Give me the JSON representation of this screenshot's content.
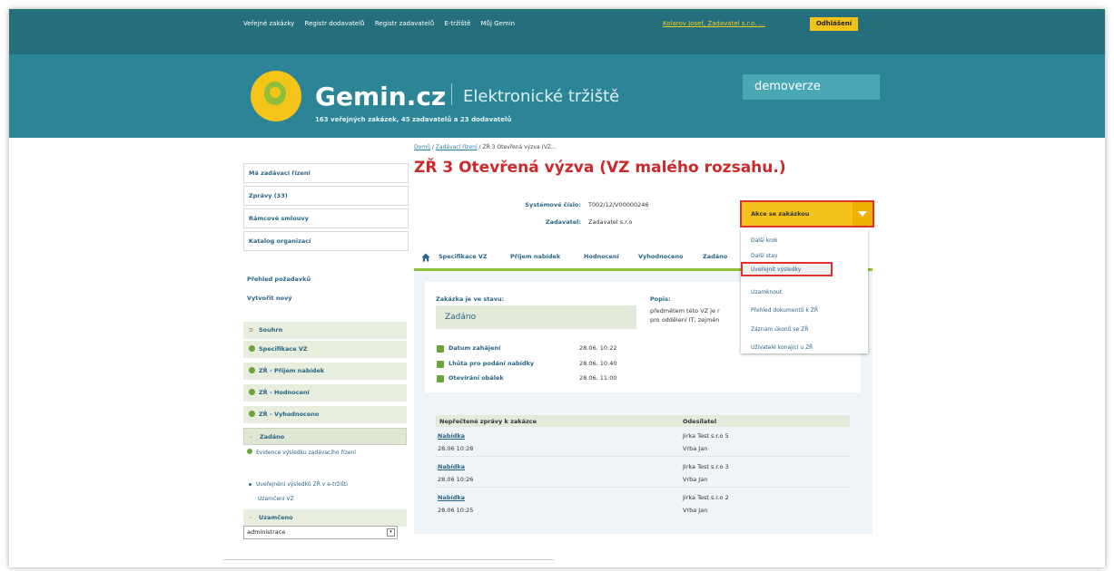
{
  "topnav": {
    "items": [
      "Veřejné zakázky",
      "Registr dodavatelů",
      "Registr zadavatelů",
      "E-tržiště",
      "Můj Gemin"
    ],
    "user": "Kolarov Josef, Zadavatel s.r.o. ...",
    "logout": "Odhlášení"
  },
  "header": {
    "brand": "Gemin.cz",
    "tagline": "Elektronické tržiště",
    "stats": "163 veřejných zakázek, 45 zadavatelů a 23 dodavatelů",
    "demo": "demoverze"
  },
  "breadcrumb": {
    "home": "Domů",
    "section": "Zadávací řízení",
    "current": " / ZŘ 3 Otevřená výzva (VZ..."
  },
  "title": "ZŘ 3 Otevřená výzva (VZ malého rozsahu.)",
  "meta": {
    "system_label": "Systémové číslo:",
    "system_value": "T002/12/V00000246",
    "contracting_label": "Zadavatel:",
    "contracting_value": "Zadavatel s.r.o"
  },
  "sidebar": {
    "boxes": [
      "Má zadávací řízení",
      "Zprávy (33)",
      "Rámcové smlouvy",
      "Katalog organizací"
    ],
    "links": [
      "Přehled požadavků",
      "Vytvořit nový"
    ],
    "summary": "Souhrn",
    "steps": [
      "Specifikace VZ",
      "ZŘ - Příjem nabídek",
      "ZŘ - Hodnocení",
      "ZŘ - Vyhodnoceno"
    ],
    "current": "Zadáno",
    "subs": [
      "Evidence výsledku zadávacího řízení",
      "Uveřejnění výsledků ZŘ v e-tržišti",
      "Uzamčení VZ"
    ],
    "locked": "Uzamčeno",
    "select_value": "administrace"
  },
  "tabs": [
    "Specifikace VZ",
    "Příjem nabídek",
    "Hodnocení",
    "Vyhodnoceno",
    "Zadáno"
  ],
  "status": {
    "label": "Zakázka je ve stavu:",
    "value": "Zadáno",
    "desc_label": "Popis:",
    "desc_line1": "předmětem této VZ je r",
    "desc_line2": "pro oddělení IT, zejmén"
  },
  "checks": [
    {
      "label": "Datum zahájení",
      "date": "28.06. 10:22"
    },
    {
      "label": "Lhůta pro podání nabídky",
      "date": "28.06. 10:40"
    },
    {
      "label": "Otevírání obálek",
      "date": "28.06. 11:00"
    }
  ],
  "messages": {
    "col1": "Nepřečtené zprávy k zakázce",
    "col2": "Odesílatel",
    "rows": [
      {
        "title": "Nabídka",
        "time": "28.06 10:28",
        "org": "Jirka Test s.r.o 5",
        "person": "Vrba Jan"
      },
      {
        "title": "Nabídka",
        "time": "28.06 10:26",
        "org": "Jirka Test s.r.o 3",
        "person": "Vrba Jan"
      },
      {
        "title": "Nabídka",
        "time": "28.06 10:25",
        "org": "Jirka Test s.r.o 2",
        "person": "Vrba Jan"
      }
    ]
  },
  "actions": {
    "button": "Akce se zakázkou",
    "menu": [
      "Další krok",
      "Další stav",
      "Uveřejnit výsledky",
      "Uzamknout",
      "Přehled dokumentů k ZŘ",
      "Záznam úkonů se ZŘ",
      "Uživatelé konající u ZŘ"
    ]
  },
  "colors": {
    "header": "#2b8596",
    "topbar": "#256f7d",
    "accent": "#f4c21b",
    "title": "#cc2a2a",
    "highlight": "#e03030"
  }
}
